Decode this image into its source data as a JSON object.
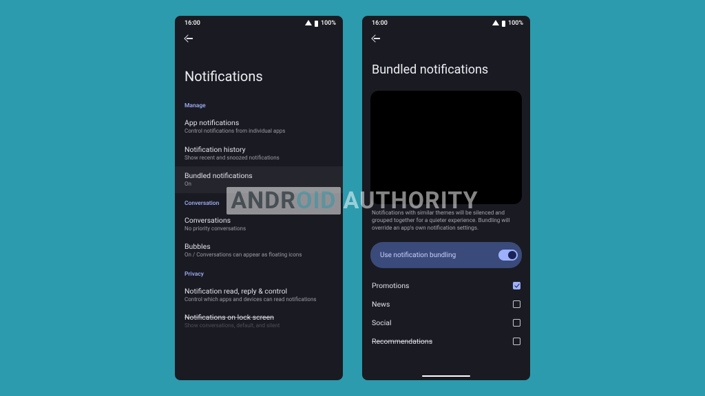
{
  "watermark": {
    "brand_a": "ANDR",
    "brand_b": "OID",
    "brand_c": "AUTHORITY"
  },
  "statusbar": {
    "time": "16:00",
    "battery": "100%"
  },
  "left": {
    "title": "Notifications",
    "sections": {
      "manage": {
        "label": "Manage",
        "items": [
          {
            "title": "App notifications",
            "sub": "Control notifications from individual apps"
          },
          {
            "title": "Notification history",
            "sub": "Show recent and snoozed notifications"
          },
          {
            "title": "Bundled notifications",
            "sub": "On"
          }
        ]
      },
      "conversation": {
        "label": "Conversation",
        "items": [
          {
            "title": "Conversations",
            "sub": "No priority conversations"
          },
          {
            "title": "Bubbles",
            "sub": "On / Conversations can appear as floating icons"
          }
        ]
      },
      "privacy": {
        "label": "Privacy",
        "items": [
          {
            "title": "Notification read, reply & control",
            "sub": "Control which apps and devices can read notifications"
          },
          {
            "title": "Notifications on lock screen",
            "sub": "Show conversations, default, and silent"
          }
        ]
      }
    }
  },
  "right": {
    "title": "Bundled notifications",
    "description": "Notifications with similar themes will be silenced and grouped together for a quieter experience. Bundling will override an app's own notification settings.",
    "toggle": {
      "label": "Use notification bundling",
      "on": true
    },
    "categories": [
      {
        "label": "Promotions",
        "checked": true
      },
      {
        "label": "News",
        "checked": false
      },
      {
        "label": "Social",
        "checked": false
      },
      {
        "label": "Recommendations",
        "checked": false
      }
    ]
  }
}
